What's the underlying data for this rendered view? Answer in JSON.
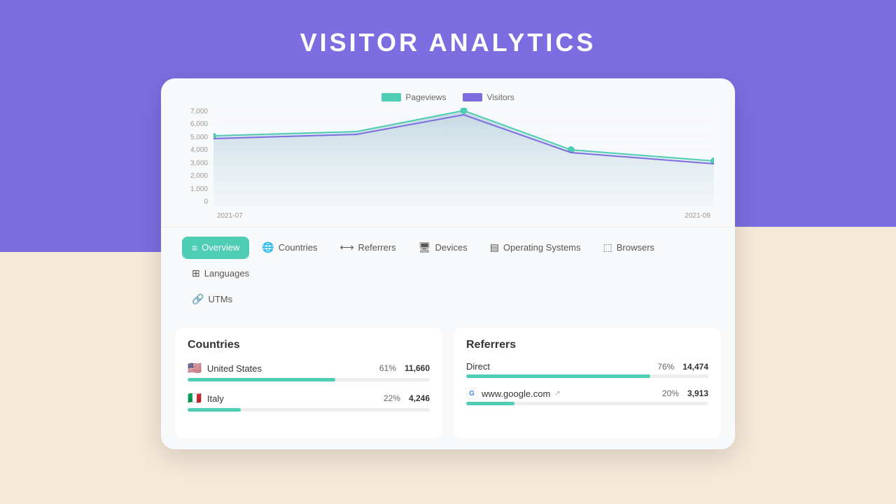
{
  "page": {
    "title": "VISITOR ANALYTICS"
  },
  "chart": {
    "legend": [
      {
        "label": "Pageviews",
        "color": "#4ecdb4"
      },
      {
        "label": "Visitors",
        "color": "#7c6ee0"
      }
    ],
    "yLabels": [
      "7,000",
      "6,000",
      "5,000",
      "4,000",
      "3,000",
      "2,000",
      "1,000",
      "0"
    ],
    "xLabels": [
      "2021-07",
      "2021-09"
    ]
  },
  "tabs": [
    {
      "label": "Overview",
      "icon": "≡",
      "active": true
    },
    {
      "label": "Countries",
      "icon": "🌐",
      "active": false
    },
    {
      "label": "Referrers",
      "icon": "⟷",
      "active": false
    },
    {
      "label": "Devices",
      "icon": "🖥",
      "active": false
    },
    {
      "label": "Operating Systems",
      "icon": "▤",
      "active": false
    },
    {
      "label": "Browsers",
      "icon": "⬚",
      "active": false
    },
    {
      "label": "Languages",
      "icon": "⊞",
      "active": false
    }
  ],
  "tabs2": [
    {
      "label": "UTMs",
      "icon": "🔗",
      "active": false
    }
  ],
  "countries_panel": {
    "title": "Countries",
    "rows": [
      {
        "flag": "🇺🇸",
        "name": "United States",
        "percent": "61%",
        "count": "11,660",
        "fill": 61
      },
      {
        "flag": "🇮🇹",
        "name": "Italy",
        "percent": "22%",
        "count": "4,246",
        "fill": 22
      }
    ]
  },
  "referrers_panel": {
    "title": "Referrers",
    "rows": [
      {
        "type": "direct",
        "name": "Direct",
        "percent": "76%",
        "count": "14,474",
        "fill": 76
      },
      {
        "type": "google",
        "name": "www.google.com",
        "percent": "20%",
        "count": "3,913",
        "fill": 20
      }
    ]
  }
}
